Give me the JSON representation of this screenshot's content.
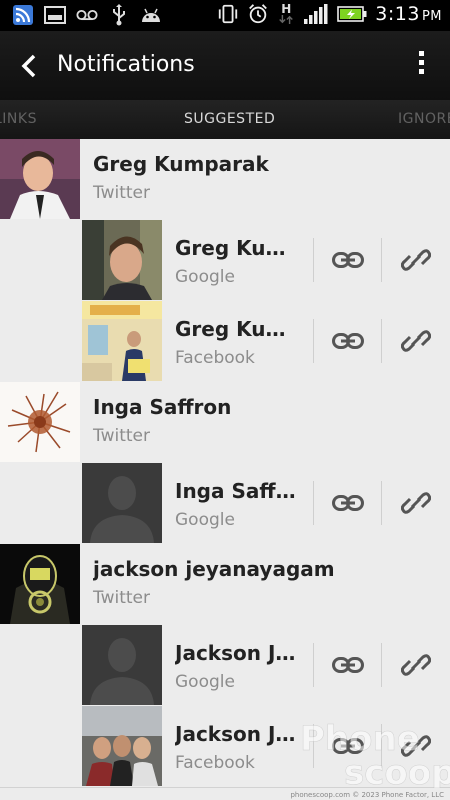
{
  "status_bar": {
    "time": "3:13",
    "ampm": "PM",
    "icons": [
      "rss-icon",
      "image-icon",
      "voicemail-icon",
      "usb-icon",
      "android-icon",
      "vibrate-icon",
      "alarm-icon",
      "hspa-data-icon",
      "signal-icon",
      "battery-charging-icon"
    ],
    "network": "H"
  },
  "action_bar": {
    "title": "Notifications"
  },
  "tabs": [
    {
      "label": "LINKS",
      "active": false
    },
    {
      "label": "SUGGESTED",
      "active": true
    },
    {
      "label": "IGNORED",
      "active": false
    }
  ],
  "rows": [
    {
      "type": "main",
      "name": "Greg Kumparak",
      "source": "Twitter"
    },
    {
      "type": "sub",
      "name": "Greg Kumparak",
      "source": "Google"
    },
    {
      "type": "sub",
      "name": "Greg Kumparak",
      "source": "Facebook"
    },
    {
      "type": "main",
      "name": "Inga Saffron",
      "source": "Twitter"
    },
    {
      "type": "sub",
      "name": "Inga Saffron",
      "source": "Google"
    },
    {
      "type": "main",
      "name": "jackson jeyanayagam",
      "source": "Twitter"
    },
    {
      "type": "sub",
      "name": "Jackson Jeyanayagam",
      "source": "Google"
    },
    {
      "type": "sub",
      "name": "Jackson Jeyanayagam",
      "source": "Facebook"
    }
  ],
  "watermark": "phone scoop",
  "footer": "phonescoop.com © 2023 Phone Factor, LLC",
  "colors": {
    "background": "#ececec",
    "action_bar": "#141414",
    "accent_battery": "#7ed321"
  }
}
